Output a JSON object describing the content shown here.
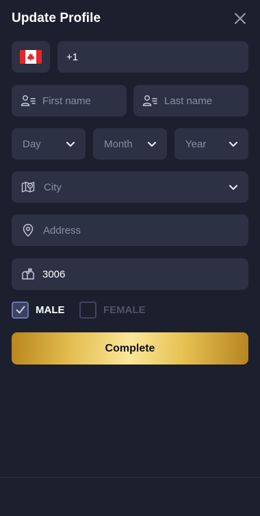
{
  "header": {
    "title": "Update Profile"
  },
  "phone": {
    "country_flag": "canada-flag-icon",
    "dial_code": "+1"
  },
  "name": {
    "first_placeholder": "First name",
    "last_placeholder": "Last name"
  },
  "dob": {
    "day_placeholder": "Day",
    "month_placeholder": "Month",
    "year_placeholder": "Year"
  },
  "city": {
    "placeholder": "City"
  },
  "address": {
    "placeholder": "Address"
  },
  "zip": {
    "value": "3006"
  },
  "gender": {
    "male_label": "MALE",
    "male_checked": true,
    "female_label": "FEMALE",
    "female_checked": false
  },
  "submit": {
    "label": "Complete"
  },
  "colors": {
    "background": "#1b1f2e",
    "field": "#2c3144",
    "accent_gold": "#e3bd4f"
  }
}
